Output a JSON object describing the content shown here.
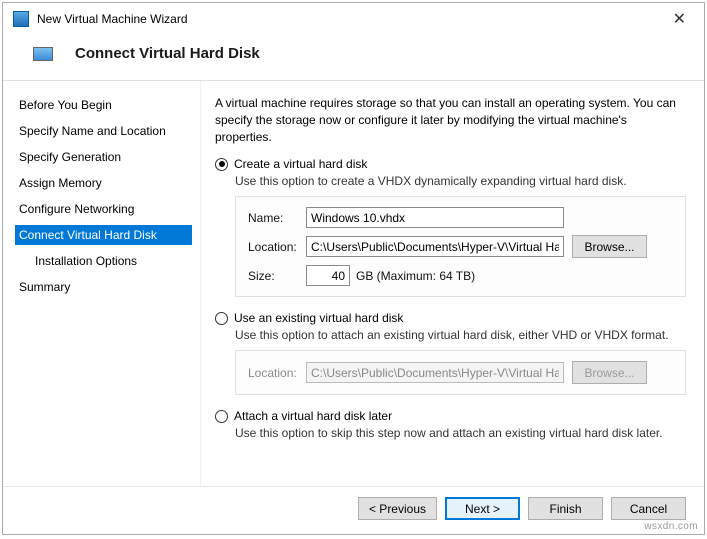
{
  "window": {
    "title": "New Virtual Machine Wizard"
  },
  "header": {
    "title": "Connect Virtual Hard Disk"
  },
  "sidebar": {
    "items": [
      {
        "label": "Before You Begin"
      },
      {
        "label": "Specify Name and Location"
      },
      {
        "label": "Specify Generation"
      },
      {
        "label": "Assign Memory"
      },
      {
        "label": "Configure Networking"
      },
      {
        "label": "Connect Virtual Hard Disk"
      },
      {
        "label": "Installation Options"
      },
      {
        "label": "Summary"
      }
    ]
  },
  "content": {
    "description": "A virtual machine requires storage so that you can install an operating system. You can specify the storage now or configure it later by modifying the virtual machine's properties.",
    "option_create": {
      "label": "Create a virtual hard disk",
      "desc": "Use this option to create a VHDX dynamically expanding virtual hard disk.",
      "name_label": "Name:",
      "name_value": "Windows 10.vhdx",
      "location_label": "Location:",
      "location_value": "C:\\Users\\Public\\Documents\\Hyper-V\\Virtual Hard Disks\\",
      "browse_label": "Browse...",
      "size_label": "Size:",
      "size_value": "40",
      "size_unit": "GB (Maximum: 64 TB)"
    },
    "option_existing": {
      "label": "Use an existing virtual hard disk",
      "desc": "Use this option to attach an existing virtual hard disk, either VHD or VHDX format.",
      "location_label": "Location:",
      "location_value": "C:\\Users\\Public\\Documents\\Hyper-V\\Virtual Hard Disks\\",
      "browse_label": "Browse..."
    },
    "option_later": {
      "label": "Attach a virtual hard disk later",
      "desc": "Use this option to skip this step now and attach an existing virtual hard disk later."
    }
  },
  "footer": {
    "previous": "< Previous",
    "next": "Next >",
    "finish": "Finish",
    "cancel": "Cancel"
  },
  "watermark": "wsxdn.com"
}
